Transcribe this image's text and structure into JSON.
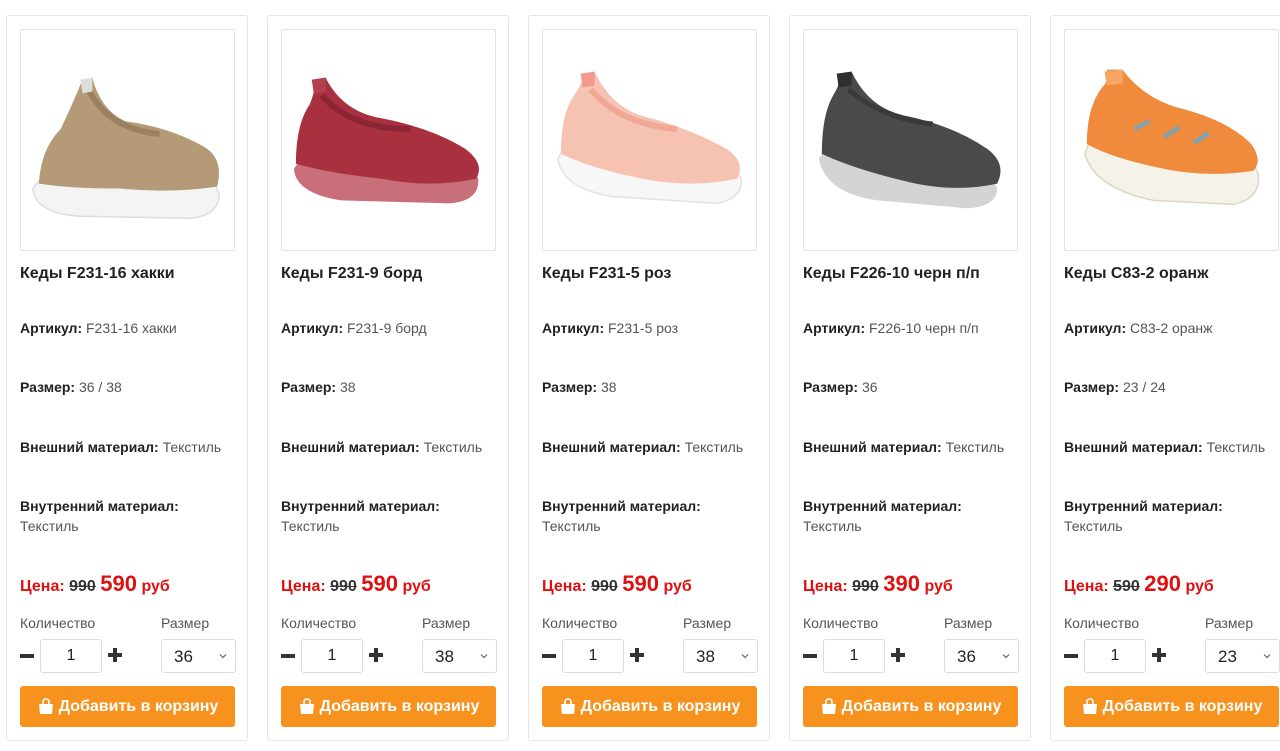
{
  "labels": {
    "article": "Артикул:",
    "size": "Размер:",
    "outer": "Внешний материал:",
    "inner": "Внутренний материал:",
    "price": "Цена:",
    "quantity": "Количество",
    "size_select": "Размер",
    "add_to_cart": "Добавить в корзину",
    "currency": "руб"
  },
  "products": [
    {
      "title": "Кеды F231-16 хакки",
      "article": "F231-16 хакки",
      "size": "36 / 38",
      "outer": "Текстиль",
      "inner": "Текстиль",
      "old_price": "990",
      "new_price": "590",
      "quantity": "1",
      "selected_size": "36",
      "shoe_color": "#b59a78",
      "sole_color": "#f4f4f4"
    },
    {
      "title": "Кеды F231-9 борд",
      "article": "F231-9 борд",
      "size": "38",
      "outer": "Текстиль",
      "inner": "Текстиль",
      "old_price": "990",
      "new_price": "590",
      "quantity": "1",
      "selected_size": "38",
      "shoe_color": "#a8303f",
      "sole_color": "#c86f7a"
    },
    {
      "title": "Кеды F231-5 роз",
      "article": "F231-5 роз",
      "size": "38",
      "outer": "Текстиль",
      "inner": "Текстиль",
      "old_price": "990",
      "new_price": "590",
      "quantity": "1",
      "selected_size": "38",
      "shoe_color": "#f6c2b2",
      "sole_color": "#f7f7f7"
    },
    {
      "title": "Кеды F226-10 черн п/п",
      "article": "F226-10 черн п/п",
      "size": "36",
      "outer": "Текстиль",
      "inner": "Текстиль",
      "old_price": "990",
      "new_price": "390",
      "quantity": "1",
      "selected_size": "36",
      "shoe_color": "#4a4a4a",
      "sole_color": "#d4d4d4"
    },
    {
      "title": "Кеды C83-2 оранж",
      "article": "C83-2 оранж",
      "size": "23 / 24",
      "outer": "Текстиль",
      "inner": "Текстиль",
      "old_price": "590",
      "new_price": "290",
      "quantity": "1",
      "selected_size": "23",
      "shoe_color": "#f08a3c",
      "sole_color": "#f5f2ea"
    }
  ],
  "colors": {
    "price_red": "#e01010",
    "button_orange": "#f7921e"
  },
  "icons": {
    "minus": "minus-icon",
    "plus": "plus-icon",
    "chevron": "chevron-down-icon",
    "bag": "shopping-bag-icon"
  }
}
